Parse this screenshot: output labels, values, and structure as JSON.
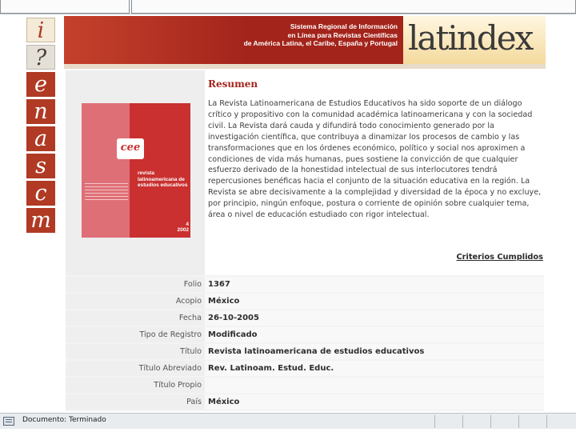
{
  "letter_nav": [
    {
      "label": "i"
    },
    {
      "label": "?"
    },
    {
      "label": "e"
    },
    {
      "label": "n"
    },
    {
      "label": "a"
    },
    {
      "label": "s"
    },
    {
      "label": "c"
    },
    {
      "label": "m"
    }
  ],
  "banner": {
    "line1": "Sistema Regional de Información",
    "line2": "en Línea para Revistas Científicas",
    "line3": "de América Latina, el Caribe, España y Portugal",
    "logo": "latindex"
  },
  "cover": {
    "acronym": "cee",
    "title": "revista latinoamericana de estudios educativos",
    "issue": "4",
    "year": "2002"
  },
  "summary": {
    "title": "Resumen",
    "text": "La Revista Latinoamericana de Estudios Educativos ha sido soporte de un diálogo crítico y propositivo con la comunidad académica latinoamericana y con la sociedad civil. La Revista dará cauda y difundirá todo conocimiento generado por la investigación científica, que contribuya a dinamizar los procesos de cambio y las transformaciones que en los órdenes económico, político y social nos aproximen a condiciones de vida más humanas, pues sostiene la convicción de que cualquier esfuerzo derivado de la honestidad intelectual de sus interlocutores tendrá repercusiones benéficas hacia el conjunto de la situación educativa en la región. La Revista se abre decisivamente a la complejidad y diversidad de la época y no excluye, por principio, ningún enfoque, postura o corriente de opinión sobre cualquier tema, área o nivel de educación estudiado con rigor intelectual.",
    "criteria_link": "Criterios Cumplidos"
  },
  "rows": [
    {
      "label": "Folio",
      "value": "1367"
    },
    {
      "label": "Acopio",
      "value": "México"
    },
    {
      "label": "Fecha",
      "value": "26-10-2005"
    },
    {
      "label": "Tipo de Registro",
      "value": "Modificado"
    },
    {
      "label": "Título",
      "value": "Revista latinoamericana de estudios educativos"
    },
    {
      "label": "Título Abreviado",
      "value": "Rev. Latinoam. Estud. Educ."
    },
    {
      "label": "Título Propio",
      "value": ""
    },
    {
      "label": "País",
      "value": "México"
    }
  ],
  "status": {
    "text": "Documento: Terminado"
  },
  "colors": {
    "brand_red": "#a3241b",
    "letter_red": "#b03a24"
  }
}
